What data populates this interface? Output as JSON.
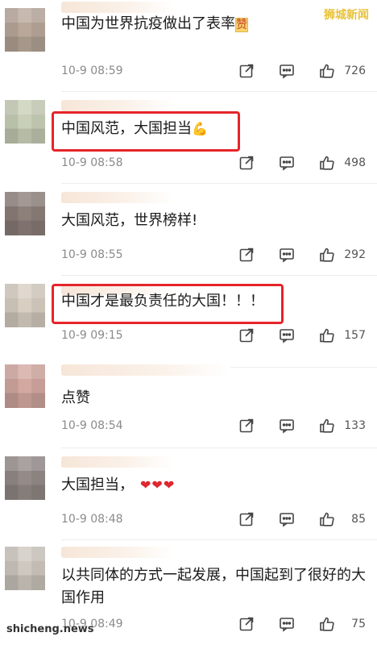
{
  "watermark": {
    "top_right": "狮城新闻",
    "bottom_left": "shicheng.news"
  },
  "comments": [
    {
      "text": "中国为世界抗疫做出了表率",
      "emoji": "赞",
      "time": "10-9 08:59",
      "likes": "726"
    },
    {
      "text": "中国风范，大国担当",
      "emoji": "💪",
      "time": "10-9 08:58",
      "likes": "498"
    },
    {
      "text": "大国风范，世界榜样!",
      "emoji": "",
      "time": "10-9 08:55",
      "likes": "292"
    },
    {
      "text": "中国才是最负责任的大国！！！",
      "emoji": "",
      "time": "10-9 09:15",
      "likes": "157"
    },
    {
      "text": "点赞",
      "emoji": "",
      "time": "10-9 08:54",
      "likes": "133"
    },
    {
      "text": "大国担当，",
      "emoji": "❤❤❤",
      "time": "10-9 08:48",
      "likes": "85"
    },
    {
      "text": "以共同体的方式一起发展，中国起到了很好的大国作用",
      "emoji": "",
      "time": "10-9 08:49",
      "likes": "75"
    }
  ],
  "icons": {
    "share": "share-icon",
    "reply": "comment-icon",
    "like": "thumbs-up-icon"
  },
  "colors": {
    "highlight": "#e5252a",
    "meta": "#8a8a8a",
    "watermark": "#e8c23a"
  }
}
